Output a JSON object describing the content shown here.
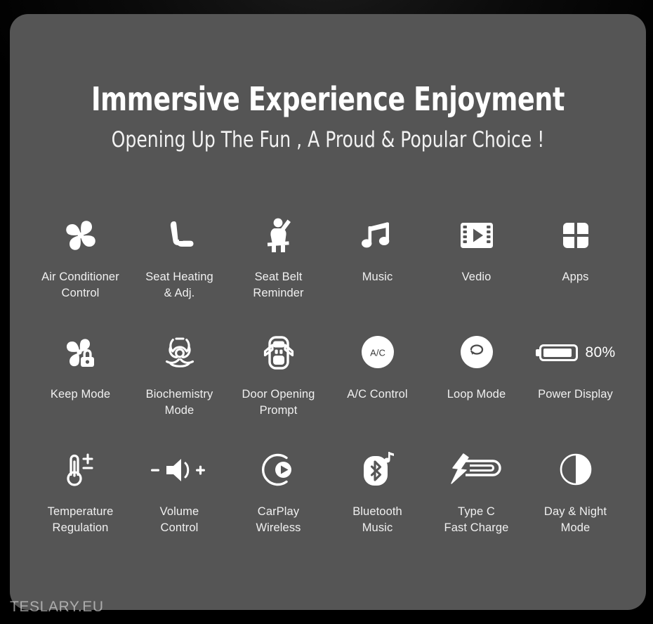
{
  "card": {
    "background_color": "#555555",
    "page_background_color": "#000000"
  },
  "header": {
    "title": "Immersive Experience Enjoyment",
    "subtitle": "Opening Up The Fun , A Proud & Popular Choice !"
  },
  "features": [
    {
      "icon": "fan-icon",
      "label": "Air Conditioner\nControl"
    },
    {
      "icon": "car-seat-icon",
      "label": "Seat Heating\n& Adj."
    },
    {
      "icon": "seatbelt-icon",
      "label": "Seat Belt\nReminder"
    },
    {
      "icon": "music-note-icon",
      "label": "Music"
    },
    {
      "icon": "film-play-icon",
      "label": "Vedio"
    },
    {
      "icon": "apps-grid-icon",
      "label": "Apps"
    },
    {
      "icon": "fan-lock-icon",
      "label": "Keep Mode"
    },
    {
      "icon": "biohazard-icon",
      "label": "Biochemistry\nMode"
    },
    {
      "icon": "car-doors-open-icon",
      "label": "Door Opening\nPrompt"
    },
    {
      "icon": "ac-circle-icon",
      "label": "A/C Control",
      "icon_text": "A/C"
    },
    {
      "icon": "loop-circle-icon",
      "label": "Loop Mode"
    },
    {
      "icon": "battery-icon",
      "label": "Power Display",
      "icon_text": "80%"
    },
    {
      "icon": "thermometer-plus-minus-icon",
      "label": "Temperature\nRegulation"
    },
    {
      "icon": "volume-icon",
      "label": "Volume\nControl"
    },
    {
      "icon": "carplay-icon",
      "label": "CarPlay\nWireless"
    },
    {
      "icon": "bluetooth-music-icon",
      "label": "Bluetooth\nMusic"
    },
    {
      "icon": "usb-c-bolt-icon",
      "label": "Type C\nFast Charge"
    },
    {
      "icon": "day-night-icon",
      "label": "Day & Night\nMode"
    }
  ],
  "watermark": {
    "text": "TESLARY.EU"
  }
}
